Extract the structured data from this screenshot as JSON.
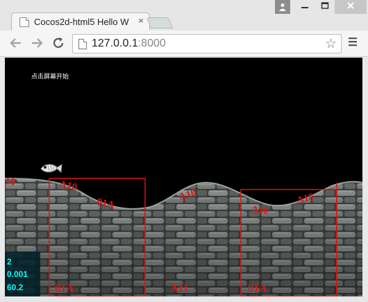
{
  "browser": {
    "tab_title": "Cocos2d-html5 Hello W",
    "tab_close": "×",
    "url_host": "127.0.0.1",
    "url_port": ":8000",
    "icons": {
      "back": "back-arrow-icon",
      "forward": "forward-arrow-icon",
      "reload": "reload-icon",
      "bookmark": "star-icon",
      "menu": "hamburger-menu-icon",
      "user": "user-icon",
      "minimize": "minimize-icon",
      "maximize": "maximize-icon",
      "close": "close-icon"
    }
  },
  "game": {
    "hint": "点击屏幕开始",
    "stats": [
      "2",
      "0.001",
      "60.2"
    ],
    "terrain_labels": [
      "10",
      "A10",
      "01A",
      "A10",
      "A10",
      "01A",
      "A11",
      "01A",
      "A10"
    ]
  },
  "colors": {
    "background": "#000000",
    "stats_text": "#00ffff",
    "marker_line": "#e01010",
    "stone": "#6a6f6c"
  }
}
